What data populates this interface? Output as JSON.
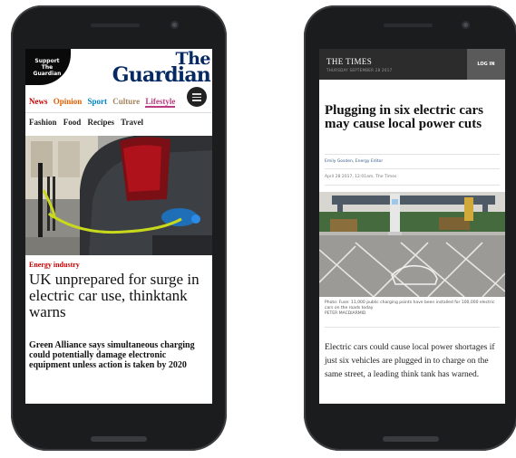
{
  "guardian": {
    "support_label": "Support The Guardian",
    "logo_line1": "The",
    "logo_line2": "Guardian",
    "nav": [
      {
        "label": "News",
        "color": "#c70000"
      },
      {
        "label": "Opinion",
        "color": "#e05e00"
      },
      {
        "label": "Sport",
        "color": "#0084c6"
      },
      {
        "label": "Culture",
        "color": "#a1845c"
      },
      {
        "label": "Lifestyle",
        "color": "#bb3b80"
      }
    ],
    "subnav": [
      "Fashion",
      "Food",
      "Recipes",
      "Travel"
    ],
    "section": "Energy industry",
    "headline": "UK unprepared for surge in electric car use, thinktank warns",
    "standfirst": "Green Alliance says simultaneous charging could potentially damage electronic equipment unless action is taken by 2020"
  },
  "times": {
    "logo": "THE TIMES",
    "date": "THURSDAY SEPTEMBER 28 2017",
    "login": "LOG IN",
    "headline": "Plugging in six electric cars may cause local power cuts",
    "byline": "Emily Gosden, Energy Editor",
    "dateline": "April 28 2017, 12:01am, The Times",
    "caption": "Photo: Fuse: 11,000 public charging points have been installed for 100,000 electric cars on the roads today",
    "caption_credit": "PETER MACDIARMID",
    "body": "Electric cars could cause local power shortages if just six vehicles are plugged in to charge on the same street, a leading think tank has warned."
  }
}
